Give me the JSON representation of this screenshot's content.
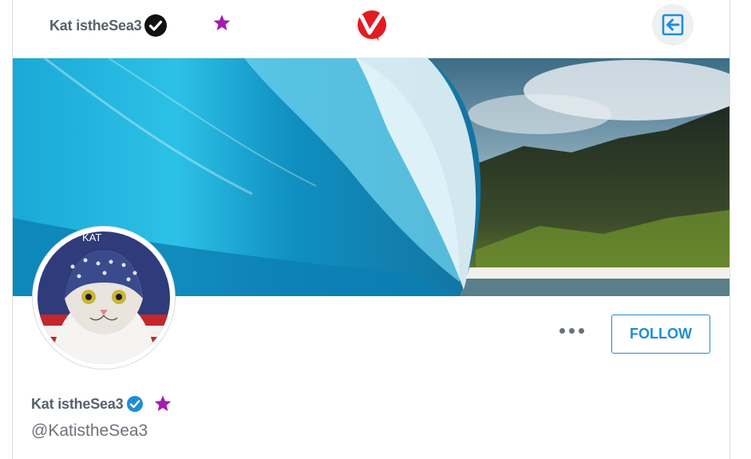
{
  "header": {
    "user_name": "Kat istheSea3",
    "logo_icon": "red-v-check-logo",
    "back_icon": "arrow-left-icon"
  },
  "profile": {
    "display_name": "Kat istheSea3",
    "handle": "@KatistheSea3",
    "avatar_text": "KAT",
    "follow_label": "FOLLOW",
    "more_icon": "more-dots-icon"
  },
  "colors": {
    "accent": "#1c8ed8",
    "star": "#a21caf",
    "logo": "#e21b22",
    "text": "#59606a"
  }
}
